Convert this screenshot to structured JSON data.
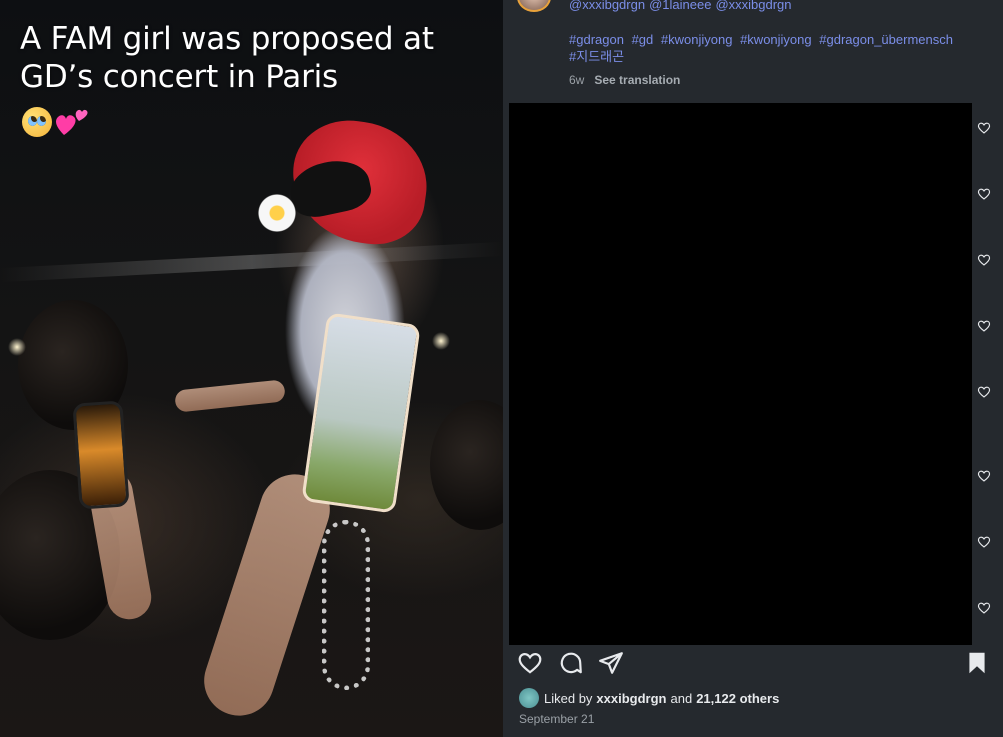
{
  "overlay": {
    "title": "A FAM girl was proposed at GD’s concert in Paris",
    "emoji": [
      "pleading-face",
      "two-hearts"
    ]
  },
  "caption": {
    "mentions": [
      "@xxxibgdrgn",
      "@1laineee",
      "@xxxibgdrgn"
    ],
    "hashtags": [
      "#gdragon",
      "#gd",
      "#kwonjiyong",
      "#kwonjiyong",
      "#gdragon_übermensch",
      "#지드래곤"
    ],
    "age": "6w",
    "see_translation": "See translation"
  },
  "comment_hearts_count": 8,
  "actions": {
    "icons": [
      "heart-icon",
      "comment-icon",
      "share-icon",
      "bookmark-icon"
    ]
  },
  "likes": {
    "prefix": "Liked by",
    "user": "xxxibgdrgn",
    "conj": "and",
    "others": "21,122 others"
  },
  "date": "September 21",
  "colors": {
    "panel_bg": "#25292e",
    "link": "#7b8ee8",
    "muted": "#9aa0a6",
    "text": "#e8eaed"
  }
}
